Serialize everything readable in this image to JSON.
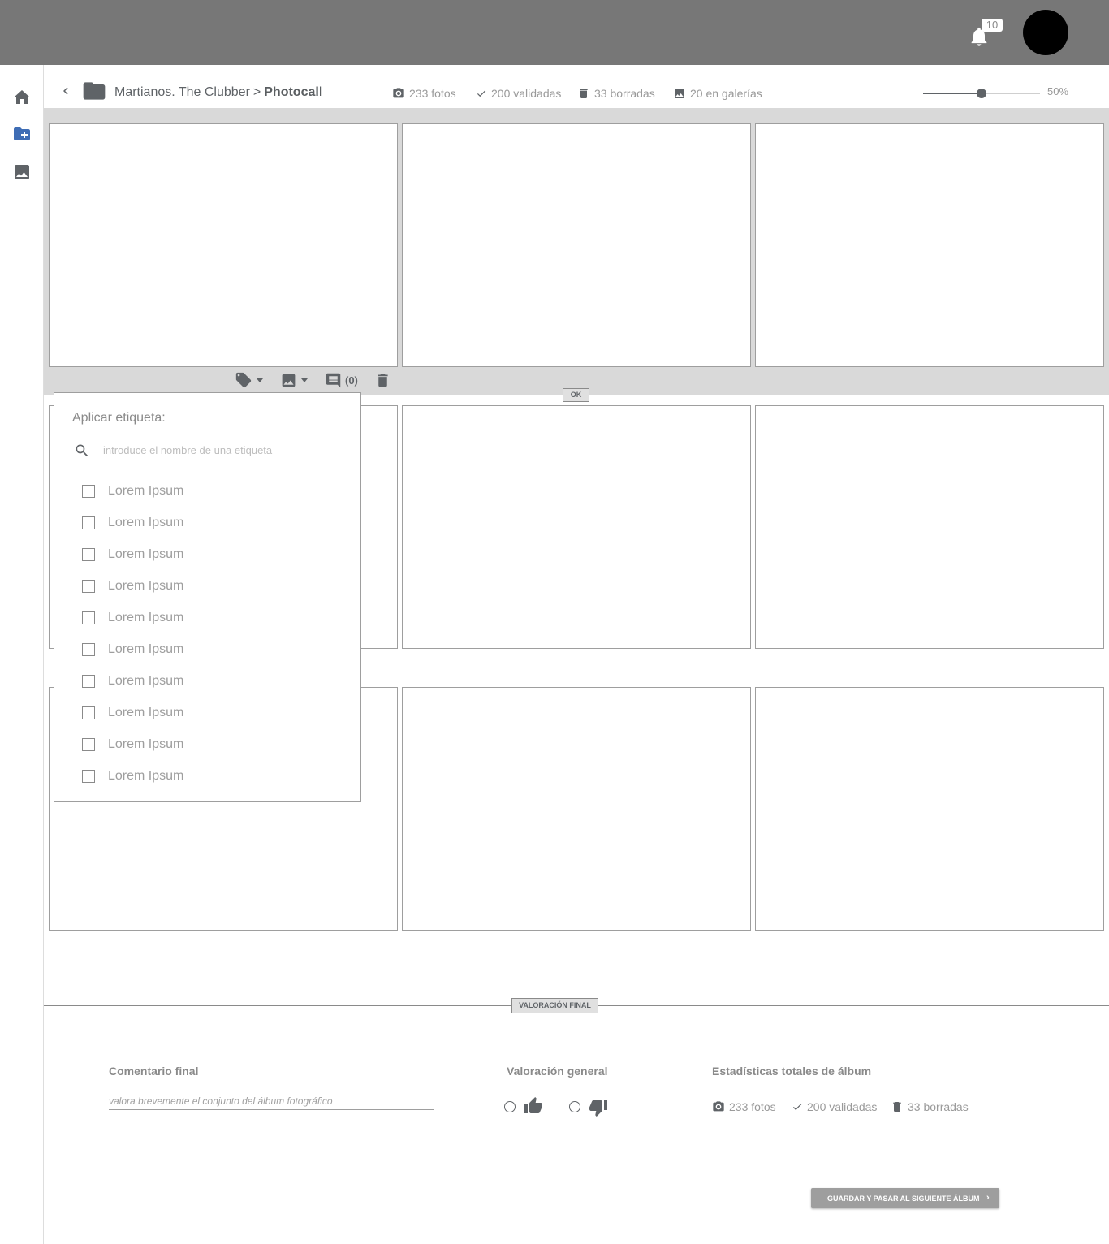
{
  "topbar": {
    "notifications_count": "10"
  },
  "header": {
    "breadcrumb_parent": "Martianos. The Clubber",
    "breadcrumb_separator": ">",
    "breadcrumb_current": "Photocall",
    "stats": {
      "photos": "233 fotos",
      "validated": "200 validadas",
      "deleted": "33 borradas",
      "in_galleries": "20 en galerías"
    },
    "zoom": {
      "value_percent": 50,
      "label": "50%"
    }
  },
  "toolbar": {
    "comments_count": "(0)"
  },
  "ok_label": "OK",
  "tag_panel": {
    "title": "Aplicar etiqueta:",
    "search_placeholder": "introduce el nombre de una etiqueta",
    "items": [
      {
        "label": "Lorem Ipsum",
        "checked": false
      },
      {
        "label": "Lorem Ipsum",
        "checked": false
      },
      {
        "label": "Lorem Ipsum",
        "checked": false
      },
      {
        "label": "Lorem Ipsum",
        "checked": false
      },
      {
        "label": "Lorem Ipsum",
        "checked": false
      },
      {
        "label": "Lorem Ipsum",
        "checked": false
      },
      {
        "label": "Lorem Ipsum",
        "checked": false
      },
      {
        "label": "Lorem Ipsum",
        "checked": false
      },
      {
        "label": "Lorem Ipsum",
        "checked": false
      },
      {
        "label": "Lorem Ipsum",
        "checked": false
      }
    ]
  },
  "final": {
    "section_label": "VALORACIÓN FINAL",
    "comment_title": "Comentario final",
    "comment_placeholder": "valora brevemente el conjunto del álbum fotográfico",
    "rating_title": "Valoración general",
    "stats_title": "Estadísticas totales de álbum",
    "stats": {
      "photos": "233 fotos",
      "validated": "200 validadas",
      "deleted": "33 borradas"
    },
    "save_button": "GUARDAR Y PASAR AL SIGUIENTE ÁLBUM"
  },
  "colors": {
    "topbar": "#777777",
    "accent_blue": "#3f6db5",
    "icon_gray": "#5f6367"
  }
}
